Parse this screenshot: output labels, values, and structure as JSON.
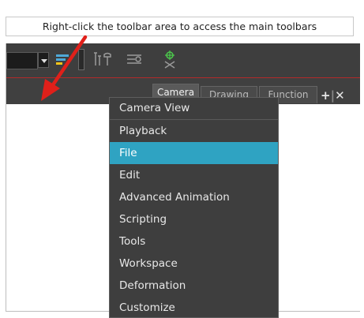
{
  "callout": {
    "text": "Right-click the toolbar area to access the main toolbars"
  },
  "colors": {
    "accent": "#2fa3c2",
    "arrow": "#e0201a",
    "toolbar_bg": "#3e3e3e",
    "menu_bg": "#3e3e3e"
  },
  "toolbar": {
    "icons": [
      "dropdown-icon",
      "layers-icon",
      "tool-props-icon",
      "deform-icon",
      "pivot-icon"
    ]
  },
  "tabs": [
    {
      "label": "Camera",
      "active": true
    },
    {
      "label": "Drawing",
      "active": false
    },
    {
      "label": "Function",
      "active": false
    }
  ],
  "tab_tools": {
    "add": "+",
    "divider": "|",
    "close": "✕"
  },
  "menu": {
    "items": [
      {
        "label": "Camera View"
      },
      {
        "label": "Playback"
      },
      {
        "label": "File",
        "selected": true
      },
      {
        "label": "Edit"
      },
      {
        "label": "Advanced Animation"
      },
      {
        "label": "Scripting"
      },
      {
        "label": "Tools"
      },
      {
        "label": "Workspace"
      },
      {
        "label": "Deformation"
      },
      {
        "label": "Customize"
      }
    ]
  }
}
